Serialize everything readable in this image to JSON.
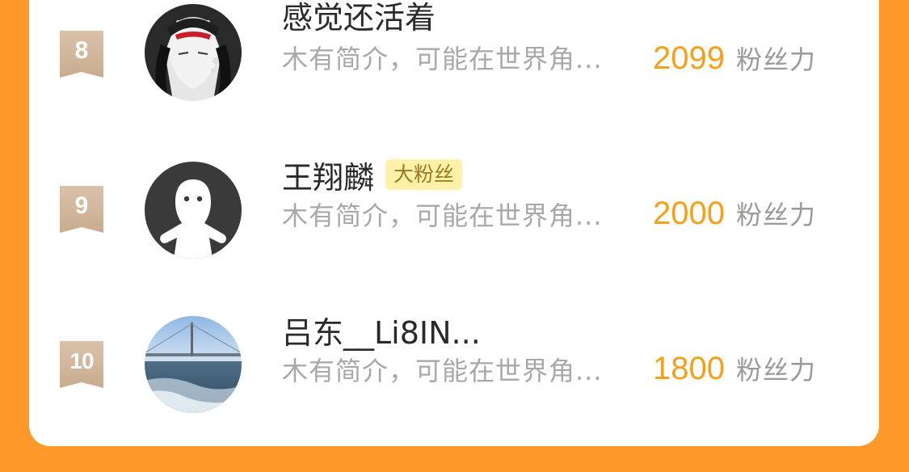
{
  "ranking": [
    {
      "rank": "8",
      "name": "感觉还活着",
      "badge": "",
      "intro": "木有简介，可能在世界角...",
      "fans": "2099",
      "fans_unit": "粉丝力",
      "avatar": "anime-girl-avatar"
    },
    {
      "rank": "9",
      "name": "王翔麟",
      "badge": "大粉丝",
      "intro": "木有简介，可能在世界角...",
      "fans": "2000",
      "fans_unit": "粉丝力",
      "avatar": "default-ghost-avatar"
    },
    {
      "rank": "10",
      "name": "吕东__Li8IN...",
      "badge": "",
      "intro": "木有简介，可能在世界角...",
      "fans": "1800",
      "fans_unit": "粉丝力",
      "avatar": "bridge-sea-avatar"
    }
  ],
  "colors": {
    "background": "#FF9A2A",
    "fans_number": "#F5A019",
    "badge_bg": "#FFF2A8"
  }
}
